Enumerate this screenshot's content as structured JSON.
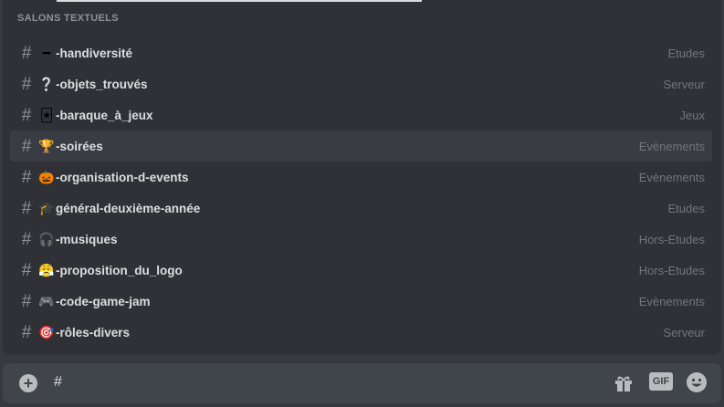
{
  "section": {
    "title": "SALONS TEXTUELS"
  },
  "channels": [
    {
      "emoji": "━",
      "name": "-handiversité",
      "category": "Etudes"
    },
    {
      "emoji": "❔",
      "name": "-objets_trouvés",
      "category": "Serveur"
    },
    {
      "emoji": "🃏",
      "name": "-baraque_à_jeux",
      "category": "Jeux"
    },
    {
      "emoji": "🏆",
      "name": "-soirées",
      "category": "Evènements"
    },
    {
      "emoji": "🎃",
      "name": "-organisation-d-events",
      "category": "Evènements"
    },
    {
      "emoji": "🎓",
      "name": "général-deuxième-année",
      "category": "Etudes"
    },
    {
      "emoji": "🎧",
      "name": "-musiques",
      "category": "Hors-Etudes"
    },
    {
      "emoji": "😤",
      "name": "-proposition_du_logo",
      "category": "Hors-Etudes"
    },
    {
      "emoji": "🎮",
      "name": "-code-game-jam",
      "category": "Evènements"
    },
    {
      "emoji": "🎯",
      "name": "-rôles-divers",
      "category": "Serveur"
    }
  ],
  "composer": {
    "text": "#",
    "gif_label": "GIF",
    "icons": [
      "plus-circle-icon",
      "gift-icon",
      "gif-icon",
      "emoji-icon"
    ]
  }
}
